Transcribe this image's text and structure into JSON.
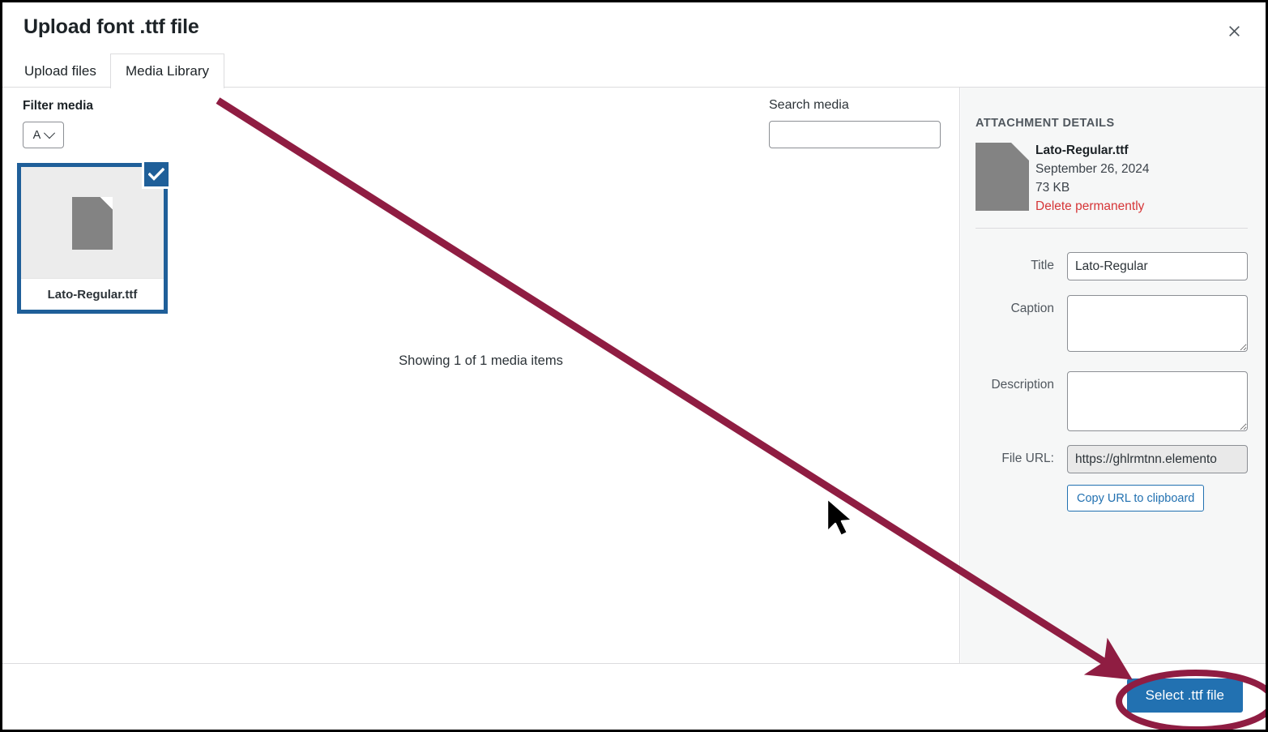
{
  "modal": {
    "title": "Upload font .ttf file",
    "close_icon": "close-icon"
  },
  "tabs": [
    {
      "label": "Upload files",
      "active": false
    },
    {
      "label": "Media Library",
      "active": true
    }
  ],
  "toolbar": {
    "filter_label": "Filter media",
    "filter_value": "A",
    "filter_icon": "chevron-down-icon",
    "search_label": "Search media",
    "search_value": "",
    "search_placeholder": ""
  },
  "grid": {
    "items": [
      {
        "filename": "Lato-Regular.ttf",
        "selected": true,
        "thumb_icon": "document-file-icon",
        "check_icon": "checkmark-icon"
      }
    ],
    "showing_text": "Showing 1 of 1 media items"
  },
  "sidebar": {
    "heading": "ATTACHMENT DETAILS",
    "thumb_icon": "document-file-icon",
    "filename": "Lato-Regular.ttf",
    "date": "September 26, 2024",
    "filesize": "73 KB",
    "delete_label": "Delete permanently",
    "fields": {
      "title_label": "Title",
      "title_value": "Lato-Regular",
      "caption_label": "Caption",
      "caption_value": "",
      "description_label": "Description",
      "description_value": "",
      "file_url_label": "File URL:",
      "file_url_value": "https://ghlrmtnn.elemento",
      "copy_button": "Copy URL to clipboard"
    }
  },
  "footer": {
    "select_button": "Select .ttf file"
  },
  "annotations": {
    "arrow_color": "#8f1d42",
    "ellipse_color": "#8f1d42",
    "cursor_icon": "mouse-pointer-icon"
  },
  "colors": {
    "primary_blue": "#2271b1",
    "selection_blue": "#1f5f99",
    "delete_red": "#d63638",
    "sidebar_bg": "#f6f7f7",
    "annotation_maroon": "#8f1d42"
  }
}
